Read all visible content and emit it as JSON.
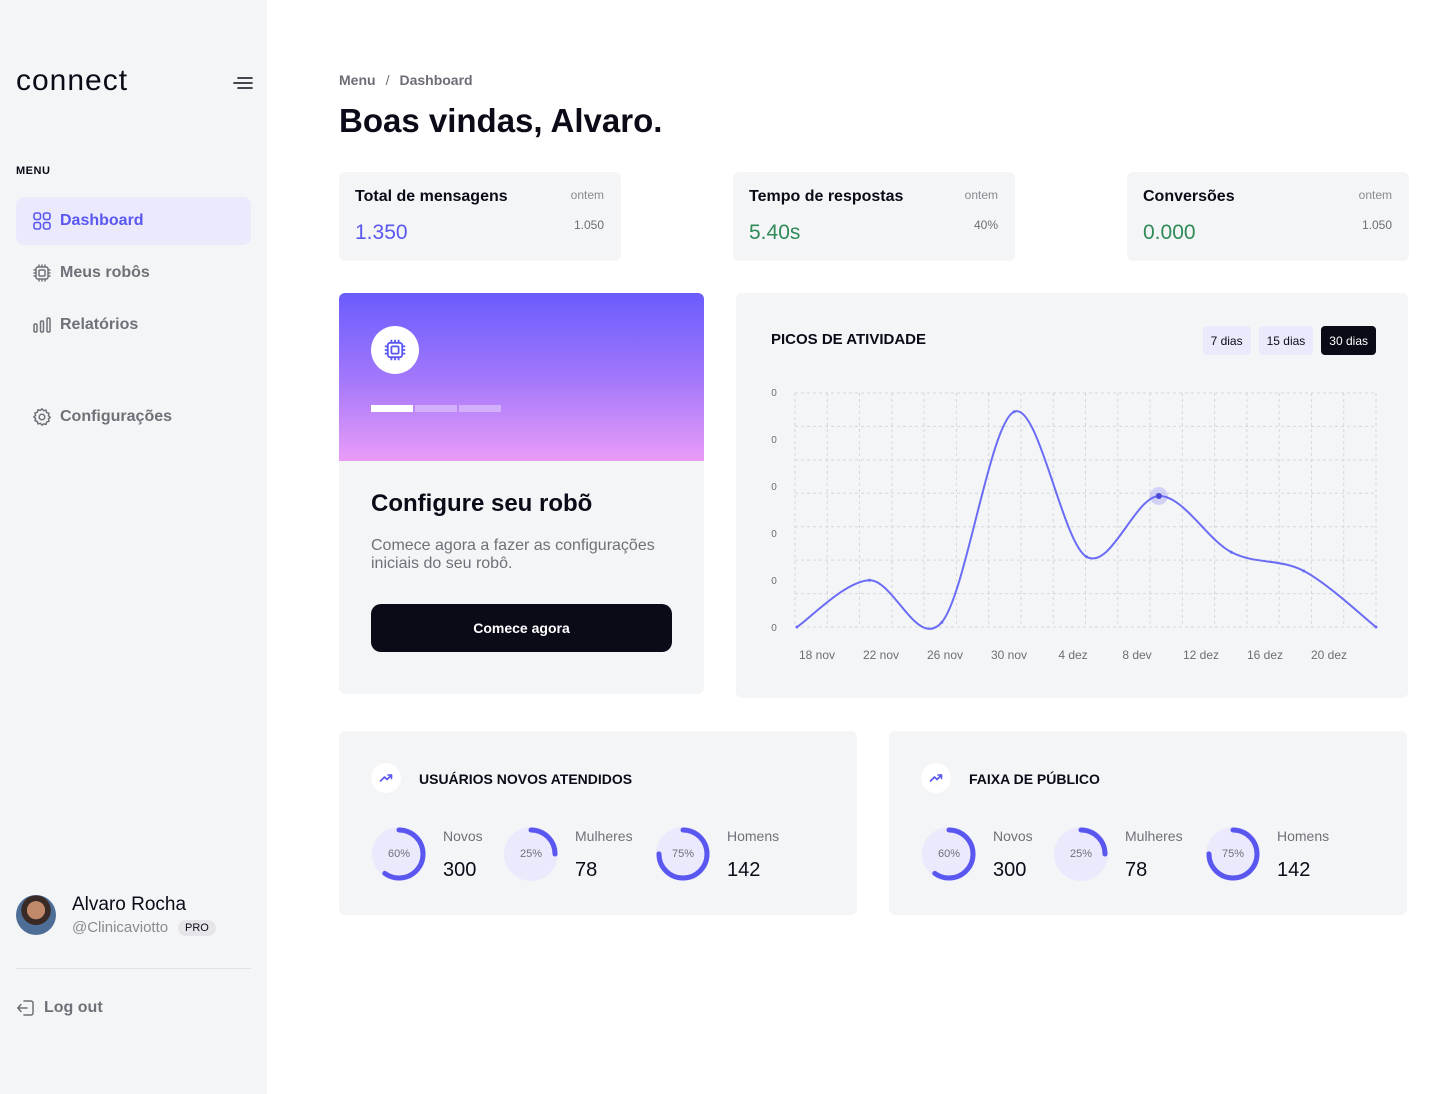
{
  "brand": {
    "logo_text": "connect"
  },
  "sidebar": {
    "section_label": "MENU",
    "items": [
      {
        "label": "Dashboard",
        "icon": "grid-icon",
        "active": true
      },
      {
        "label": "Meus robôs",
        "icon": "chip-icon",
        "active": false
      },
      {
        "label": "Relatórios",
        "icon": "bar-chart-icon",
        "active": false
      },
      {
        "label": "Configurações",
        "icon": "gear-icon",
        "active": false
      }
    ],
    "user": {
      "name": "Alvaro Rocha",
      "handle": "@Clinicaviotto",
      "badge": "PRO"
    },
    "logout_label": "Log out"
  },
  "breadcrumb": {
    "root": "Menu",
    "separator": "/",
    "current": "Dashboard"
  },
  "page_title": "Boas vindas, Alvaro.",
  "stats": [
    {
      "label": "Total de mensagens",
      "value": "1.350",
      "prev_label": "ontem",
      "prev_value": "1.050",
      "color": "#5a57f0"
    },
    {
      "label": "Tempo de respostas",
      "value": "5.40s",
      "prev_label": "ontem",
      "prev_value": "40%",
      "color": "#2e8a57"
    },
    {
      "label": "Conversões",
      "value": "0.000",
      "prev_label": "ontem",
      "prev_value": "1.050",
      "color": "#2e8a57"
    }
  ],
  "robot_card": {
    "title": "Configure seu robõ",
    "description": "Comece agora a fazer as configurações iniciais do seu robô.",
    "button_label": "Comece agora",
    "progress_steps_total": 3,
    "progress_steps_done": 1
  },
  "activity": {
    "title": "PICOS DE ATIVIDADE",
    "ranges": [
      {
        "label": "7 dias",
        "active": false
      },
      {
        "label": "15 dias",
        "active": false
      },
      {
        "label": "30 dias",
        "active": true
      }
    ]
  },
  "chart_data": {
    "type": "line",
    "title": "PICOS DE ATIVIDADE",
    "x": [
      "18 nov",
      "22 nov",
      "26 nov",
      "30 nov",
      "4 dez",
      "8 dev",
      "12 dez",
      "16 dez",
      "20 dez"
    ],
    "y_tick_labels": [
      "0",
      "0",
      "0",
      "0",
      "0",
      "0"
    ],
    "series": [
      {
        "values": [
          0,
          1.0,
          0.1,
          4.6,
          1.5,
          2.8,
          1.6,
          1.2,
          0.0
        ]
      }
    ],
    "highlight_index": 5,
    "ylim": [
      0,
      5
    ],
    "grid": true,
    "color": "#6b6cf5"
  },
  "bottom_cards": [
    {
      "title": "USUÁRIOS NOVOS ATENDIDOS",
      "metrics": [
        {
          "label": "Novos",
          "value": "300",
          "percent_label": "60%",
          "percent": 60
        },
        {
          "label": "Mulheres",
          "value": "78",
          "percent_label": "25%",
          "percent": 25
        },
        {
          "label": "Homens",
          "value": "142",
          "percent_label": "75%",
          "percent": 75
        }
      ]
    },
    {
      "title": "FAIXA DE PÚBLICO",
      "metrics": [
        {
          "label": "Novos",
          "value": "300",
          "percent_label": "60%",
          "percent": 60
        },
        {
          "label": "Mulheres",
          "value": "78",
          "percent_label": "25%",
          "percent": 25
        },
        {
          "label": "Homens",
          "value": "142",
          "percent_label": "75%",
          "percent": 75
        }
      ]
    }
  ],
  "colors": {
    "accent": "#5a57f0",
    "positive": "#2e8a57",
    "dark": "#0b0b18"
  }
}
